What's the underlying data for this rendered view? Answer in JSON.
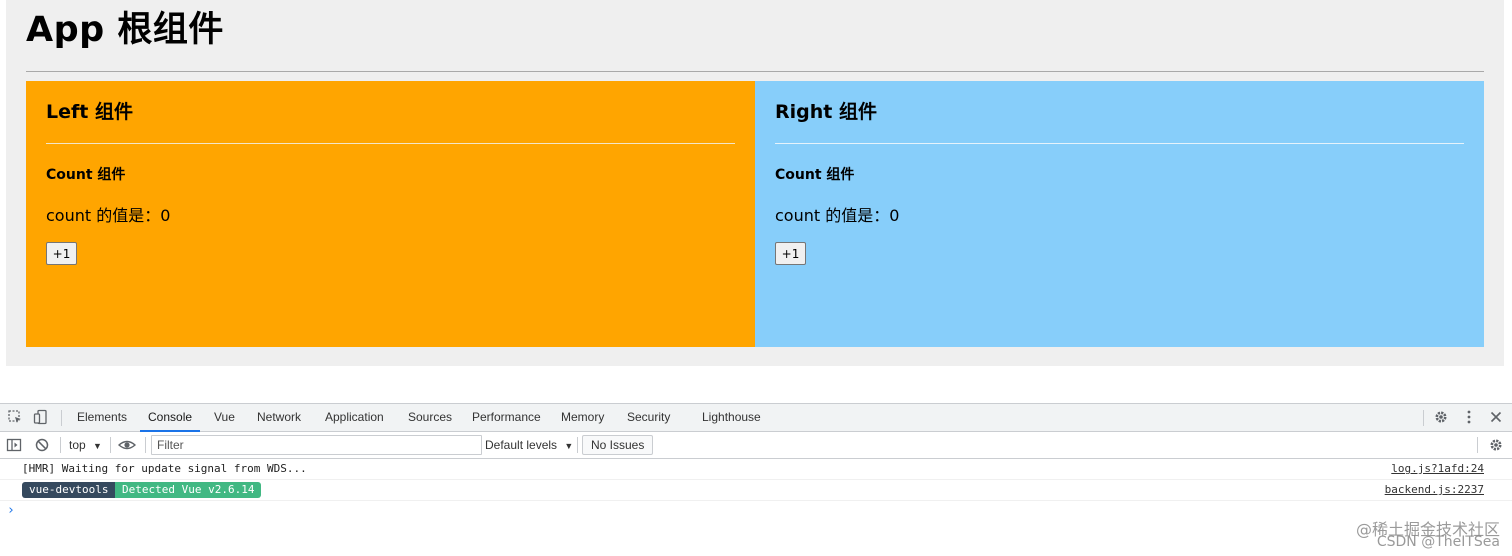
{
  "app": {
    "title": "App 根组件",
    "panels": [
      {
        "title": "Left 组件",
        "count_title": "Count 组件",
        "count_text": "count 的值是：0",
        "button_label": "+1",
        "color": "#ffa500"
      },
      {
        "title": "Right 组件",
        "count_title": "Count 组件",
        "count_text": "count 的值是：0",
        "button_label": "+1",
        "color": "#87cefa"
      }
    ]
  },
  "devtools": {
    "tabs": [
      "Elements",
      "Console",
      "Vue",
      "Network",
      "Application",
      "Sources",
      "Performance",
      "Memory",
      "Security",
      "Lighthouse"
    ],
    "active_tab": "Console",
    "toolbar": {
      "context": "top",
      "filter_placeholder": "Filter",
      "levels": "Default levels",
      "issues": "No Issues"
    },
    "logs": [
      {
        "text": "[HMR] Waiting for update signal from WDS...",
        "source": "log.js?1afd:24"
      },
      {
        "badge1": "vue-devtools",
        "badge2": "Detected Vue v2.6.14",
        "source": "backend.js:2237"
      }
    ],
    "prompt": "›",
    "accent": "#1a73e8"
  },
  "watermark": {
    "line1": "@稀土掘金技术社区",
    "line2": "CSDN @TheITSea"
  }
}
